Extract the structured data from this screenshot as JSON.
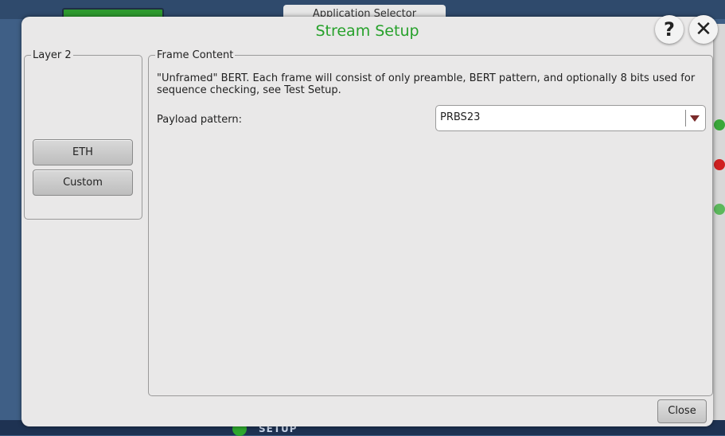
{
  "background": {
    "tab_label": "Application Selector",
    "bottom_label": "SETUP"
  },
  "dialog": {
    "title": "Stream Setup",
    "help_label": "?",
    "close_icon_label": "✕",
    "close_button": "Close"
  },
  "layer2": {
    "legend": "Layer 2",
    "buttons": [
      "ETH",
      "Custom"
    ]
  },
  "frame_content": {
    "legend": "Frame Content",
    "description": "\"Unframed\" BERT. Each frame will consist of only preamble, BERT pattern, and optionally 8 bits used for sequence checking, see Test Setup.",
    "payload_label": "Payload pattern:",
    "payload_value": "PRBS23"
  },
  "colors": {
    "title": "#27a12b",
    "dialog_bg": "#e9e8e8",
    "app_bg": "#3f5f86"
  }
}
